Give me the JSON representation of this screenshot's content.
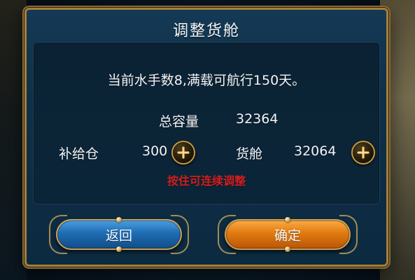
{
  "dialog": {
    "title": "调整货舱",
    "summary": "当前水手数8,满载可航行150天。",
    "capacity": {
      "label": "总容量",
      "value": "32364"
    },
    "supply": {
      "label": "补给仓",
      "value": "300"
    },
    "cargo": {
      "label": "货舱",
      "value": "32064"
    },
    "hint": "按住可连续调整",
    "buttons": {
      "back": "返回",
      "confirm": "确定"
    },
    "icons": {
      "plus": "plus-icon"
    },
    "colors": {
      "hint_red": "#d11f1f",
      "back_blue": "#1e6db3",
      "confirm_orange": "#e07b10",
      "gold_border": "#a57f3d"
    }
  }
}
